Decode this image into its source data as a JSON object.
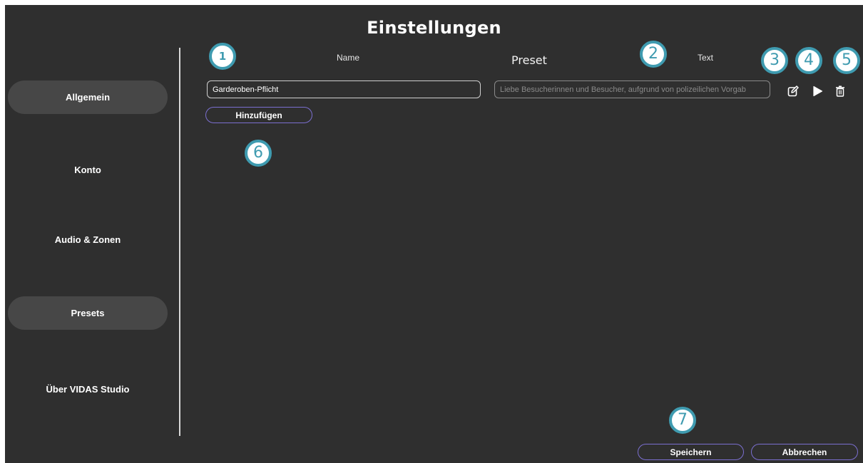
{
  "window": {
    "title": "Einstellungen"
  },
  "sidebar": {
    "items": [
      {
        "label": "Allgemein"
      },
      {
        "label": "Konto"
      },
      {
        "label": "Audio & Zonen"
      },
      {
        "label": "Presets"
      },
      {
        "label": "Über VIDAS Studio"
      }
    ]
  },
  "presets": {
    "heading": "Preset",
    "columns": {
      "name": "Name",
      "text": "Text"
    },
    "rows": [
      {
        "name": "Garderoben-Pflicht",
        "text": "Liebe Besucherinnen und Besucher, aufgrund von polizeilichen Vorgab",
        "icons": [
          "edit-icon",
          "play-icon",
          "trash-icon"
        ]
      }
    ],
    "add_button": "Hinzufügen"
  },
  "footer": {
    "save_button": "Speichern",
    "cancel_button": "Abbrechen"
  },
  "annotations": {
    "markers": [
      "1",
      "2",
      "3",
      "4",
      "5",
      "6",
      "7"
    ],
    "marker_color": "#3f9bb0"
  },
  "colors": {
    "background": "#2f2f2f",
    "highlight": "#474747",
    "button_border": "#7b6fd0"
  }
}
